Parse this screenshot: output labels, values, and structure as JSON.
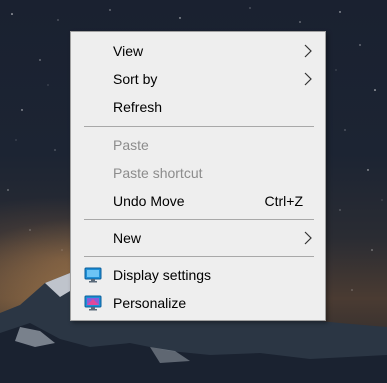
{
  "context_menu": {
    "items": [
      {
        "label": "View",
        "has_submenu": true
      },
      {
        "label": "Sort by",
        "has_submenu": true
      },
      {
        "label": "Refresh"
      },
      {
        "label": "Paste",
        "disabled": true
      },
      {
        "label": "Paste shortcut",
        "disabled": true
      },
      {
        "label": "Undo Move",
        "shortcut": "Ctrl+Z"
      },
      {
        "label": "New",
        "has_submenu": true
      },
      {
        "label": "Display settings",
        "icon": "display-settings-icon"
      },
      {
        "label": "Personalize",
        "icon": "personalize-icon"
      }
    ]
  },
  "colors": {
    "menu_background": "#eeeeee",
    "menu_border": "#a0a0a0",
    "disabled_text": "#8c8c8c",
    "separator": "#a8a8a8",
    "icon_blue": "#1e8fd6"
  }
}
